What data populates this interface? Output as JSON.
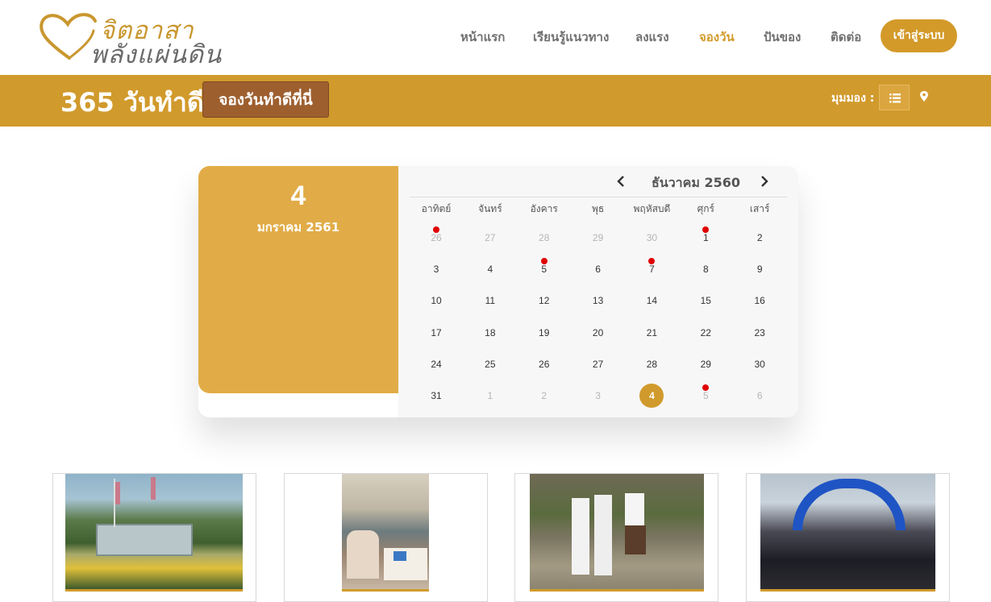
{
  "logo": {
    "line1": "จิตอาสา",
    "line2": "พลังแผ่นดิน"
  },
  "nav": {
    "items": [
      {
        "label": "หน้าแรก"
      },
      {
        "label": "เรียนรู้แนวทาง"
      },
      {
        "label": "ลงแรง"
      },
      {
        "label": "จองวัน"
      },
      {
        "label": "ปันของ"
      },
      {
        "label": "ติดต่อ"
      }
    ],
    "active": "จองวัน",
    "login_label": "เข้าสู่ระบบ"
  },
  "band": {
    "title": "365 วันทำดี",
    "book_label": "จองวันทำดีที่นี่",
    "view_label": "มุมมอง :",
    "view_icons": [
      "list-icon",
      "map-pin-icon"
    ]
  },
  "calendar": {
    "selected": {
      "day": "4",
      "month_year": "มกราคม 2561"
    },
    "header_title": "ธันวาคม 2560",
    "weekdays": [
      "อาทิตย์",
      "จันทร์",
      "อังคาร",
      "พุธ",
      "พฤหัสบดี",
      "ศุกร์",
      "เสาร์"
    ],
    "weeks": [
      [
        {
          "d": "26",
          "other": true,
          "event": true
        },
        {
          "d": "27",
          "other": true
        },
        {
          "d": "28",
          "other": true
        },
        {
          "d": "29",
          "other": true
        },
        {
          "d": "30",
          "other": true
        },
        {
          "d": "1",
          "event": true
        },
        {
          "d": "2"
        }
      ],
      [
        {
          "d": "3"
        },
        {
          "d": "4"
        },
        {
          "d": "5",
          "event": true
        },
        {
          "d": "6"
        },
        {
          "d": "7",
          "event": true
        },
        {
          "d": "8"
        },
        {
          "d": "9"
        }
      ],
      [
        {
          "d": "10"
        },
        {
          "d": "11"
        },
        {
          "d": "12"
        },
        {
          "d": "13"
        },
        {
          "d": "14"
        },
        {
          "d": "15"
        },
        {
          "d": "16"
        }
      ],
      [
        {
          "d": "17"
        },
        {
          "d": "18"
        },
        {
          "d": "19"
        },
        {
          "d": "20"
        },
        {
          "d": "21"
        },
        {
          "d": "22"
        },
        {
          "d": "23"
        }
      ],
      [
        {
          "d": "24"
        },
        {
          "d": "25"
        },
        {
          "d": "26"
        },
        {
          "d": "27"
        },
        {
          "d": "28"
        },
        {
          "d": "29"
        },
        {
          "d": "30"
        }
      ],
      [
        {
          "d": "31"
        },
        {
          "d": "1",
          "other": true
        },
        {
          "d": "2",
          "other": true
        },
        {
          "d": "3",
          "other": true
        },
        {
          "d": "4",
          "today": true
        },
        {
          "d": "5",
          "other": true,
          "event": true
        },
        {
          "d": "6",
          "other": true
        }
      ]
    ]
  },
  "cards": [
    {
      "photo": "school-sign-garden"
    },
    {
      "photo": "people-at-table"
    },
    {
      "photo": "students-sweeping"
    },
    {
      "photo": "run-event-crowd"
    }
  ],
  "colors": {
    "gold": "#d19a2c",
    "light_gold": "#e1ac47",
    "brown_button": "#9e5f2f",
    "event_dot": "#e00000"
  }
}
